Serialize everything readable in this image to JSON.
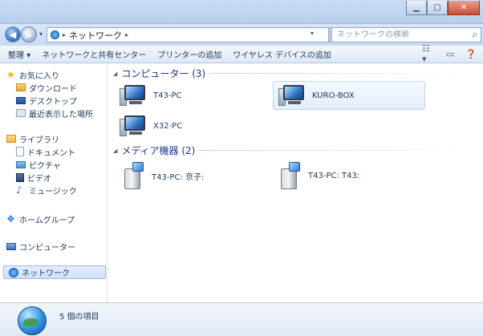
{
  "navigation": {
    "back_label": "◀",
    "forward_label": "▶",
    "address_path": [
      "ネットワーク"
    ],
    "search_placeholder": "ネットワークの検索"
  },
  "toolbar": {
    "items": [
      "整理 ▾",
      "ネットワークと共有センター",
      "プリンターの追加",
      "ワイヤレス デバイスの追加"
    ]
  },
  "sidebar": {
    "favorites_label": "お気に入り",
    "favorites_items": [
      "ダウンロード",
      "デスクトップ",
      "最近表示した場所"
    ],
    "libraries_label": "ライブラリ",
    "libraries_items": [
      "ドキュメント",
      "ピクチャ",
      "ビデオ",
      "ミュージック"
    ],
    "homegroup_label": "ホームグループ",
    "computer_label": "コンピューター",
    "network_label": "ネットワーク"
  },
  "main": {
    "groups": [
      {
        "title": "コンピューター (3)",
        "items": [
          {
            "label": "T43-PC",
            "selected": false
          },
          {
            "label": "KURO-BOX",
            "selected": true
          },
          {
            "label": "X32-PC",
            "selected": false
          }
        ]
      },
      {
        "title": "メディア機器 (2)",
        "items": [
          {
            "label": "T43-PC: 京子:"
          },
          {
            "label": "T43-PC: T43:"
          }
        ]
      }
    ]
  },
  "status": {
    "item_count": "5 個の項目"
  },
  "colors": {
    "accent": "#1e3287",
    "selection": "#cfe0f6"
  }
}
